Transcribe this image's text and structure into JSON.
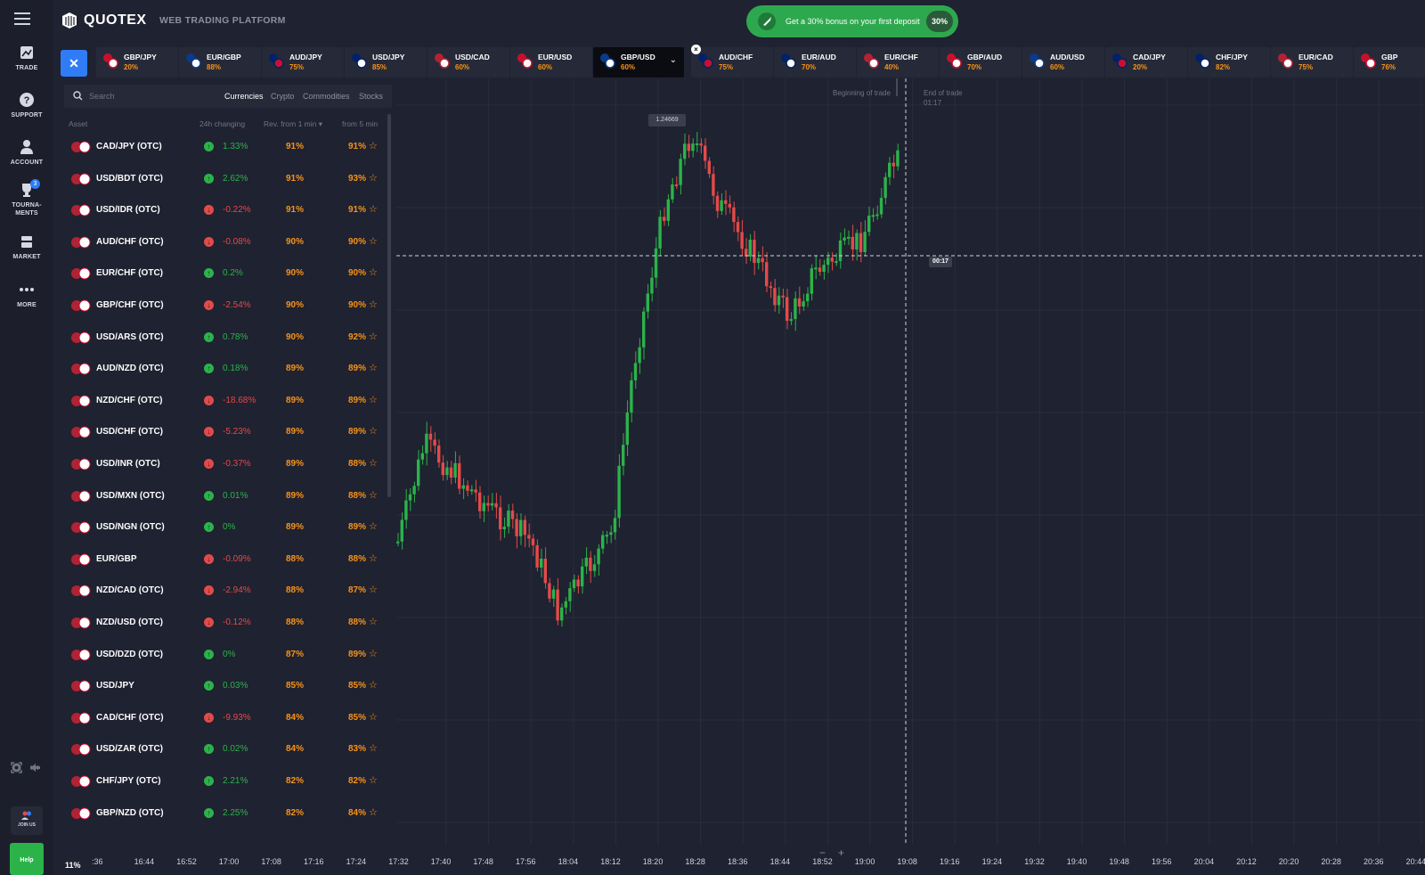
{
  "app": {
    "name": "QUOTEX",
    "platform": "WEB TRADING PLATFORM"
  },
  "promo": {
    "text": "Get a 30% bonus on your first deposit",
    "percent": "30%"
  },
  "nav": [
    {
      "label": "TRADE",
      "icon": "chart-icon"
    },
    {
      "label": "SUPPORT",
      "icon": "help-icon"
    },
    {
      "label": "ACCOUNT",
      "icon": "user-icon"
    },
    {
      "label": "TOURNA-\nMENTS",
      "icon": "trophy-icon",
      "badge": "3"
    },
    {
      "label": "MARKET",
      "icon": "market-icon"
    },
    {
      "label": "MORE",
      "icon": "more-icon"
    }
  ],
  "bottom_rail": {
    "join_label": "JOIN US",
    "help_label": "Help"
  },
  "tabs": [
    {
      "pair": "GBP/JPY",
      "pct": "20%"
    },
    {
      "pair": "EUR/GBP",
      "pct": "88%"
    },
    {
      "pair": "AUD/JPY",
      "pct": "75%"
    },
    {
      "pair": "USD/JPY",
      "pct": "85%"
    },
    {
      "pair": "USD/CAD",
      "pct": "60%"
    },
    {
      "pair": "EUR/USD",
      "pct": "60%"
    },
    {
      "pair": "GBP/USD",
      "pct": "60%",
      "active": true
    },
    {
      "pair": "AUD/CHF",
      "pct": "75%"
    },
    {
      "pair": "EUR/AUD",
      "pct": "70%"
    },
    {
      "pair": "EUR/CHF",
      "pct": "40%"
    },
    {
      "pair": "GBP/AUD",
      "pct": "70%"
    },
    {
      "pair": "AUD/USD",
      "pct": "60%"
    },
    {
      "pair": "CAD/JPY",
      "pct": "20%"
    },
    {
      "pair": "CHF/JPY",
      "pct": "82%"
    },
    {
      "pair": "EUR/CAD",
      "pct": "75%"
    },
    {
      "pair": "GBP",
      "pct": "76%"
    }
  ],
  "panel": {
    "search_placeholder": "Search",
    "categories": [
      "Currencies",
      "Crypto",
      "Commodities",
      "Stocks"
    ],
    "columns": {
      "asset": "Asset",
      "change": "24h changing",
      "rev1": "Rev. from 1 min ▾",
      "rev5": "from 5 min"
    },
    "rows": [
      {
        "name": "CAD/JPY (OTC)",
        "dir": "up",
        "change": "1.33%",
        "r1": "91%",
        "r5": "91%"
      },
      {
        "name": "USD/BDT (OTC)",
        "dir": "up",
        "change": "2.62%",
        "r1": "91%",
        "r5": "93%"
      },
      {
        "name": "USD/IDR (OTC)",
        "dir": "down",
        "change": "-0.22%",
        "r1": "91%",
        "r5": "91%"
      },
      {
        "name": "AUD/CHF (OTC)",
        "dir": "down",
        "change": "-0.08%",
        "r1": "90%",
        "r5": "90%"
      },
      {
        "name": "EUR/CHF (OTC)",
        "dir": "up",
        "change": "0.2%",
        "r1": "90%",
        "r5": "90%"
      },
      {
        "name": "GBP/CHF (OTC)",
        "dir": "down",
        "change": "-2.54%",
        "r1": "90%",
        "r5": "90%"
      },
      {
        "name": "USD/ARS (OTC)",
        "dir": "up",
        "change": "0.78%",
        "r1": "90%",
        "r5": "92%"
      },
      {
        "name": "AUD/NZD (OTC)",
        "dir": "up",
        "change": "0.18%",
        "r1": "89%",
        "r5": "89%"
      },
      {
        "name": "NZD/CHF (OTC)",
        "dir": "down",
        "change": "-18.68%",
        "r1": "89%",
        "r5": "89%"
      },
      {
        "name": "USD/CHF (OTC)",
        "dir": "down",
        "change": "-5.23%",
        "r1": "89%",
        "r5": "89%"
      },
      {
        "name": "USD/INR (OTC)",
        "dir": "down",
        "change": "-0.37%",
        "r1": "89%",
        "r5": "88%"
      },
      {
        "name": "USD/MXN (OTC)",
        "dir": "up",
        "change": "0.01%",
        "r1": "89%",
        "r5": "88%"
      },
      {
        "name": "USD/NGN (OTC)",
        "dir": "up",
        "change": "0%",
        "r1": "89%",
        "r5": "89%"
      },
      {
        "name": "EUR/GBP",
        "dir": "down",
        "change": "-0.09%",
        "r1": "88%",
        "r5": "88%"
      },
      {
        "name": "NZD/CAD (OTC)",
        "dir": "down",
        "change": "-2.94%",
        "r1": "88%",
        "r5": "87%"
      },
      {
        "name": "NZD/USD (OTC)",
        "dir": "down",
        "change": "-0.12%",
        "r1": "88%",
        "r5": "88%"
      },
      {
        "name": "USD/DZD (OTC)",
        "dir": "up",
        "change": "0%",
        "r1": "87%",
        "r5": "89%"
      },
      {
        "name": "USD/JPY",
        "dir": "up",
        "change": "0.03%",
        "r1": "85%",
        "r5": "85%"
      },
      {
        "name": "CAD/CHF (OTC)",
        "dir": "down",
        "change": "-9.93%",
        "r1": "84%",
        "r5": "85%"
      },
      {
        "name": "USD/ZAR (OTC)",
        "dir": "up",
        "change": "0.02%",
        "r1": "84%",
        "r5": "83%"
      },
      {
        "name": "CHF/JPY (OTC)",
        "dir": "up",
        "change": "2.21%",
        "r1": "82%",
        "r5": "82%"
      },
      {
        "name": "GBP/NZD (OTC)",
        "dir": "up",
        "change": "2.25%",
        "r1": "82%",
        "r5": "84%"
      }
    ],
    "bottom_pct": "11%"
  },
  "chart": {
    "price_tag": "1.24669",
    "beginning_label": "Beginning of trade",
    "end_label": "End of trade",
    "end_time": "01:17",
    "timer": "00:17",
    "time_labels": [
      ":36",
      "16:44",
      "16:52",
      "17:00",
      "17:08",
      "17:16",
      "17:24",
      "17:32",
      "17:40",
      "17:48",
      "17:56",
      "18:04",
      "18:12",
      "18:20",
      "18:28",
      "18:36",
      "18:44",
      "18:52",
      "19:00",
      "19:08",
      "19:16",
      "19:24",
      "19:32",
      "19:40",
      "19:48",
      "19:56",
      "20:04",
      "20:12",
      "20:20",
      "20:28",
      "20:36",
      "20:44"
    ],
    "colors": {
      "up": "#2bb34a",
      "down": "#e34a4a",
      "grid": "#2a2e3c"
    }
  }
}
